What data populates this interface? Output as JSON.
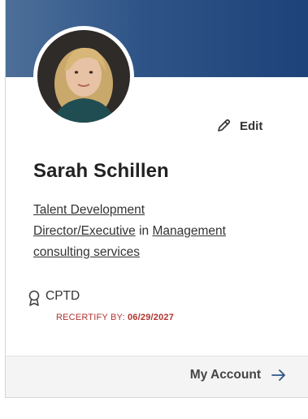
{
  "profile": {
    "name": "Sarah Schillen",
    "edit_label": "Edit",
    "role_part1": "Talent Development",
    "role_part2": "Director/Executive",
    "role_connector": " in ",
    "industry_part1": "Management",
    "industry_part2": "consulting services"
  },
  "certification": {
    "name": "CPTD",
    "recertify_label": "RECERTIFY BY:",
    "recertify_date": "06/29/2027"
  },
  "footer": {
    "account_label": "My Account"
  },
  "colors": {
    "banner": "#1d427a",
    "recertify": "#b0342f",
    "footer_bg": "#f4f4f4"
  },
  "icons": {
    "edit": "pencil-icon",
    "certification": "ribbon-badge-icon",
    "account": "arrow-right-icon"
  }
}
